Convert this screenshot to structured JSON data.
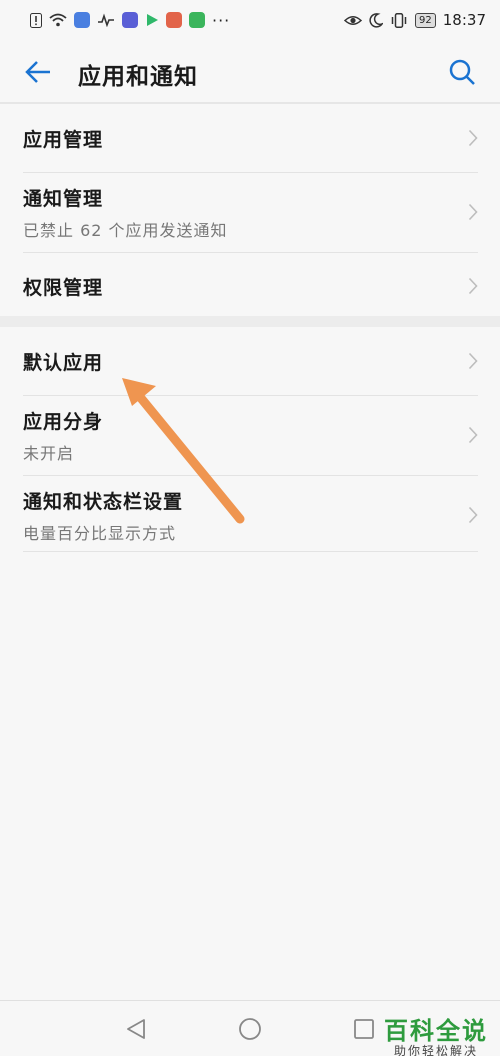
{
  "status_bar": {
    "time": "18:37",
    "battery": "92",
    "left_icons": [
      "alert-icon",
      "wifi-icon",
      "app-icon",
      "activity-icon",
      "app-icon",
      "play-icon",
      "app-icon",
      "app-icon",
      "more-icon"
    ],
    "right_icons": [
      "eye-icon",
      "moon-icon",
      "vibrate-icon",
      "battery-icon"
    ]
  },
  "header": {
    "title": "应用和通知",
    "accent_color": "#1a73d1"
  },
  "groups": [
    {
      "items": [
        {
          "label": "应用管理",
          "sub": ""
        },
        {
          "label": "通知管理",
          "sub": "已禁止 62 个应用发送通知"
        },
        {
          "label": "权限管理",
          "sub": ""
        }
      ]
    },
    {
      "items": [
        {
          "label": "默认应用",
          "sub": ""
        },
        {
          "label": "应用分身",
          "sub": "未开启"
        },
        {
          "label": "通知和状态栏设置",
          "sub": "电量百分比显示方式"
        }
      ]
    }
  ],
  "annotation": {
    "arrow_color": "#ef9550"
  },
  "watermark": {
    "main": "百科全说",
    "sub": "助你轻松解决"
  }
}
